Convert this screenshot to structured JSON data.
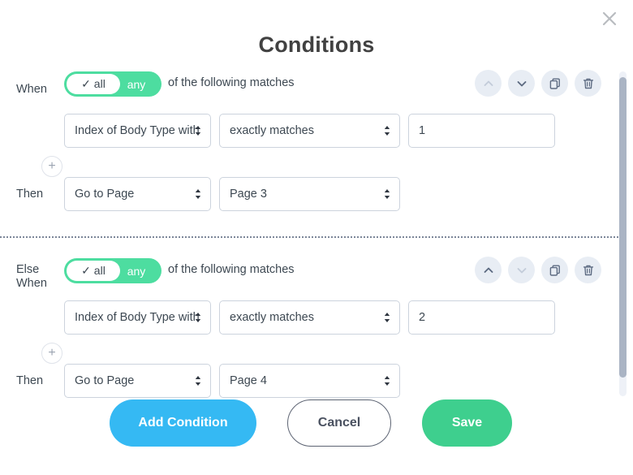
{
  "dialog": {
    "title": "Conditions",
    "close_icon": "close-icon"
  },
  "toggle": {
    "all_label": "✓ all",
    "any_label": "any",
    "selected": "all"
  },
  "matches_text": "of the following matches",
  "labels": {
    "when": "When",
    "else_when": "Else\nWhen",
    "else_when_line1": "Else",
    "else_when_line2": "When",
    "then": "Then",
    "add_plus": "+"
  },
  "actions": {
    "move_up_icon": "chevron-up-icon",
    "move_down_icon": "chevron-down-icon",
    "duplicate_icon": "duplicate-icon",
    "delete_icon": "trash-icon"
  },
  "conditions": [
    {
      "label": "When",
      "subject": "Index of Body Type with",
      "operator": "exactly matches",
      "value": "1",
      "action": "Go to Page",
      "target": "Page 3",
      "move_up_enabled": false,
      "move_down_enabled": true
    },
    {
      "label": "Else When",
      "subject": "Index of Body Type with",
      "operator": "exactly matches",
      "value": "2",
      "action": "Go to Page",
      "target": "Page 4",
      "move_up_enabled": true,
      "move_down_enabled": false
    }
  ],
  "footer": {
    "add_condition_label": "Add Condition",
    "cancel_label": "Cancel",
    "save_label": "Save"
  },
  "colors": {
    "toggle_green": "#4ddda0",
    "add_blue": "#35b9f3",
    "save_green": "#3ecf8e",
    "icon_bg": "#e8edf4",
    "scrollbar_thumb": "#aab4c4"
  }
}
